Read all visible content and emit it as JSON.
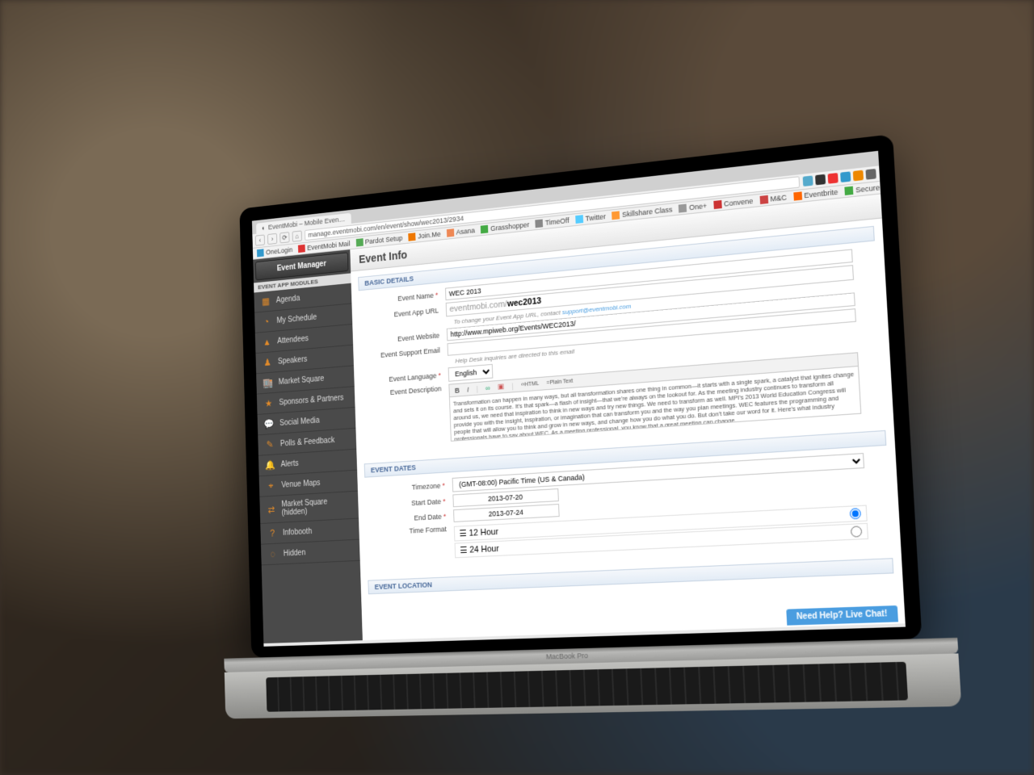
{
  "browser": {
    "tab_title": "EventMobi – Mobile Even…",
    "url": "manage.eventmobi.com/en/event/show/wec2013/2934",
    "bookmarks": [
      "OneLogin",
      "EventMobi Mail",
      "Pardot Setup",
      "Join.Me",
      "Asana",
      "Grasshopper",
      "TimeOff",
      "Twitter",
      "Skillshare Class",
      "One+",
      "Convene",
      "M&C",
      "Eventbrite",
      "Secure Passcode"
    ]
  },
  "sidebar": {
    "title": "Event Manager",
    "section": "EVENT APP MODULES",
    "items": [
      {
        "icon": "agenda-icon",
        "label": "Agenda"
      },
      {
        "icon": "clock-icon",
        "label": "My Schedule"
      },
      {
        "icon": "attendees-icon",
        "label": "Attendees"
      },
      {
        "icon": "speakers-icon",
        "label": "Speakers"
      },
      {
        "icon": "market-icon",
        "label": "Market Square"
      },
      {
        "icon": "star-icon",
        "label": "Sponsors & Partners"
      },
      {
        "icon": "chat-icon",
        "label": "Social Media"
      },
      {
        "icon": "polls-icon",
        "label": "Polls & Feedback"
      },
      {
        "icon": "bell-icon",
        "label": "Alerts"
      },
      {
        "icon": "map-icon",
        "label": "Venue Maps"
      },
      {
        "icon": "market-icon",
        "label": "Market Square (hidden)"
      },
      {
        "icon": "info-icon",
        "label": "Infobooth"
      },
      {
        "icon": "hidden-icon",
        "label": "Hidden"
      }
    ]
  },
  "page": {
    "title": "Event Info",
    "sections": {
      "basic": {
        "header": "BASIC DETAILS",
        "fields": {
          "name_label": "Event Name",
          "name_value": "WEC 2013",
          "appurl_label": "Event App URL",
          "appurl_prefix": "eventmobi.com/",
          "appurl_value": "wec2013",
          "appurl_hint_pre": "To change your Event App URL, contact ",
          "appurl_hint_link": "support@eventmobi.com",
          "website_label": "Event Website",
          "website_value": "http://www.mpiweb.org/Events/WEC2013/",
          "support_label": "Event Support Email",
          "support_value": "",
          "support_hint": "Help Desk inquiries are directed to this email",
          "lang_label": "Event Language",
          "lang_value": "English",
          "desc_label": "Event Description",
          "desc_value": "Transformation can happen in many ways, but all transformation shares one thing in common—it starts with a single spark, a catalyst that ignites change and sets it on its course. It's that spark—a flash of insight—that we're always on the lookout for. As the meeting industry continues to transform all around us, we need that inspiration to think in new ways and try new things. We need to transform as well. MPI's 2013 World Education Congress will provide you with the insight, inspiration, or imagination that can transform you and the way you plan meetings. WEC features the programming and people that will allow you to think and grow in new ways, and change how you do what you do. But don't take our word for it. Here's what industry professionals have to say about WEC. As a meeting professional, you know that a great meeting can change",
          "rt_plain": "Plain Text"
        }
      },
      "dates": {
        "header": "EVENT DATES",
        "tz_label": "Timezone",
        "tz_value": "(GMT-08:00) Pacific Time (US & Canada)",
        "start_label": "Start Date",
        "start_value": "2013-07-20",
        "end_label": "End Date",
        "end_value": "2013-07-24",
        "format_label": "Time Format",
        "opt12": "12 Hour",
        "opt24": "24 Hour"
      },
      "location": {
        "header": "EVENT LOCATION"
      }
    }
  },
  "livechat": "Need Help? Live Chat!",
  "laptop_label": "MacBook Pro"
}
